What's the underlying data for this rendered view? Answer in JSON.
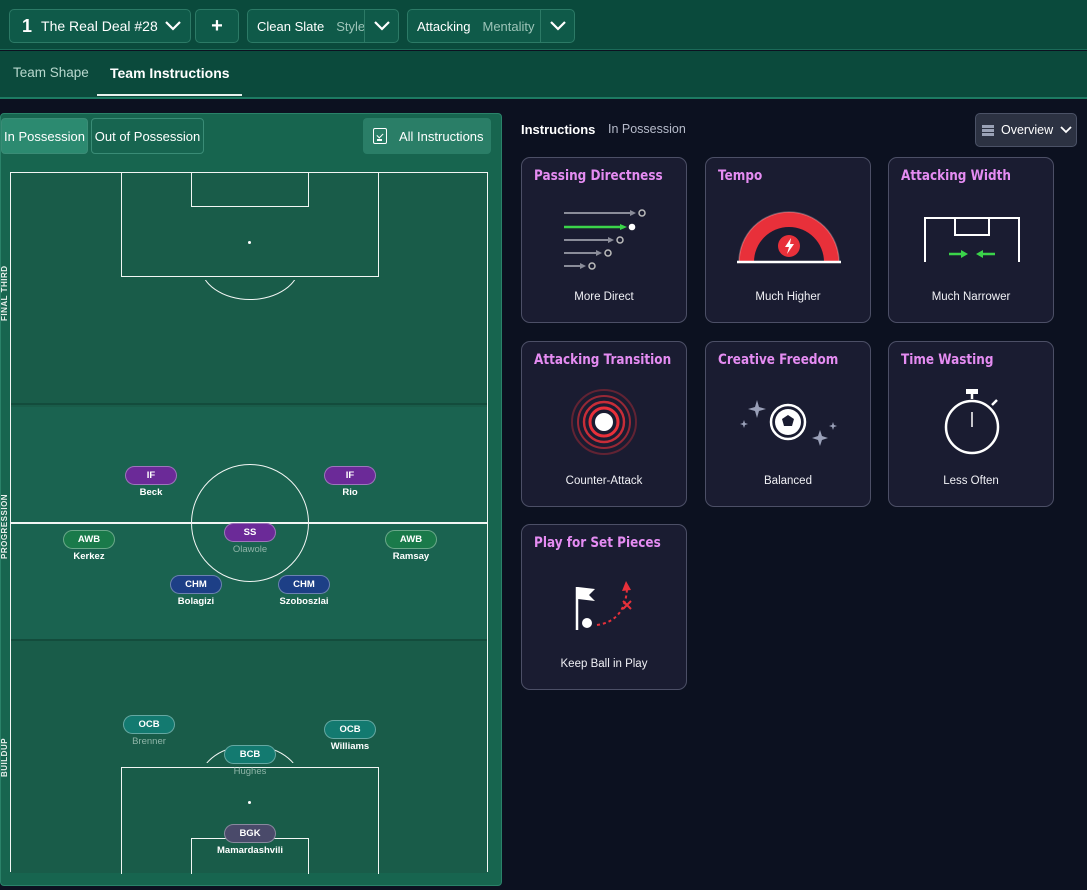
{
  "topbar": {
    "tactic_number": "1",
    "tactic_name": "The Real Deal #28",
    "add_label": "+",
    "style_label": "Clean Slate",
    "style_sub": "Style",
    "mentality_label": "Attacking",
    "mentality_sub": "Mentality"
  },
  "tabs": [
    {
      "label": "Team Shape"
    },
    {
      "label": "Team Instructions"
    }
  ],
  "pitch_panel": {
    "in_possession": "In Possession",
    "out_of_possession": "Out of Possession",
    "all_instructions": "All Instructions",
    "zones": [
      "FINAL THIRD",
      "PROGRESSION",
      "BUILDUP"
    ]
  },
  "players": [
    {
      "role": "IF",
      "name": "Beck"
    },
    {
      "role": "IF",
      "name": "Rio"
    },
    {
      "role": "SS",
      "name": "Olawole"
    },
    {
      "role": "AWB",
      "name": "Kerkez"
    },
    {
      "role": "AWB",
      "name": "Ramsay"
    },
    {
      "role": "CHM",
      "name": "Bolagizi"
    },
    {
      "role": "CHM",
      "name": "Szoboszlai"
    },
    {
      "role": "OCB",
      "name": "Brenner"
    },
    {
      "role": "OCB",
      "name": "Williams"
    },
    {
      "role": "BCB",
      "name": "Hughes"
    },
    {
      "role": "BGK",
      "name": "Mamardashvili"
    }
  ],
  "instructions": {
    "title": "Instructions",
    "subtitle": "In Possession",
    "view_label": "Overview",
    "cards": [
      {
        "title": "Passing Directness",
        "value": "More Direct",
        "icon": "passing-arrows-icon"
      },
      {
        "title": "Tempo",
        "value": "Much Higher",
        "icon": "tempo-gauge-icon"
      },
      {
        "title": "Attacking Width",
        "value": "Much Narrower",
        "icon": "width-arrows-icon"
      },
      {
        "title": "Attacking Transition",
        "value": "Counter-Attack",
        "icon": "transition-rings-icon"
      },
      {
        "title": "Creative Freedom",
        "value": "Balanced",
        "icon": "ball-sparkles-icon"
      },
      {
        "title": "Time Wasting",
        "value": "Less Often",
        "icon": "stopwatch-icon"
      },
      {
        "title": "Play for Set Pieces",
        "value": "Keep Ball in Play",
        "icon": "corner-flag-icon"
      }
    ]
  },
  "colors": {
    "accent_title": "#e58cf2",
    "role_forward": "#6b2a98",
    "role_midfield": "#1d3f86",
    "role_wingback": "#1a7a4a",
    "role_defender": "#137a70",
    "role_keeper": "#4a4a6a",
    "tempo_red": "#e8303a",
    "width_green": "#3bd44a"
  }
}
